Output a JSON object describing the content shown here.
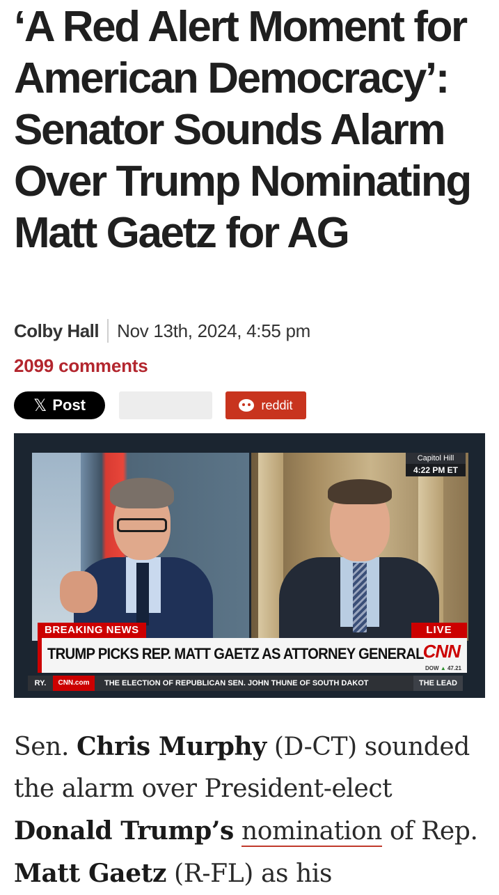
{
  "article": {
    "headline": "‘A Red Alert Moment for American Democracy’: Senator Sounds Alarm Over Trump Nominating Matt Gaetz for AG",
    "author": "Colby Hall",
    "date": "Nov 13th, 2024, 4:55 pm",
    "comments": "2099 comments"
  },
  "share": {
    "x_icon": "x-logo-icon",
    "x_label": "Post",
    "reddit_icon": "reddit-alien-icon",
    "reddit_label": "reddit"
  },
  "video": {
    "location": "Capitol Hill",
    "time": "4:22 PM ET",
    "breaking": "BREAKING NEWS",
    "live": "LIVE",
    "lower_third": "TRUMP PICKS REP. MATT GAETZ AS ATTORNEY GENERAL",
    "network_logo": "CNN",
    "dow_label": "DOW",
    "dow_arrow": "▲",
    "dow_value": "47.21",
    "ticker_prefix": "RY.",
    "ticker_site": "CNN.com",
    "ticker_text": "THE ELECTION OF REPUBLICAN SEN. JOHN THUNE OF SOUTH DAKOT",
    "ticker_show": "THE LEAD"
  },
  "body": {
    "p1_a": "Sen. ",
    "p1_name1": "Chris Murphy",
    "p1_b": " (D-CT) sounded the alarm over President-elect ",
    "p1_name2": "Donald Trump’s",
    "p1_c": " ",
    "p1_link": "nomination",
    "p1_d": " of Rep. ",
    "p1_name3": "Matt Gaetz",
    "p1_e": " (R-FL) as his"
  },
  "colors": {
    "accent_red": "#b3262e",
    "reddit": "#c8341e",
    "x_button": "#000000",
    "cnn_red": "#cc0000"
  }
}
